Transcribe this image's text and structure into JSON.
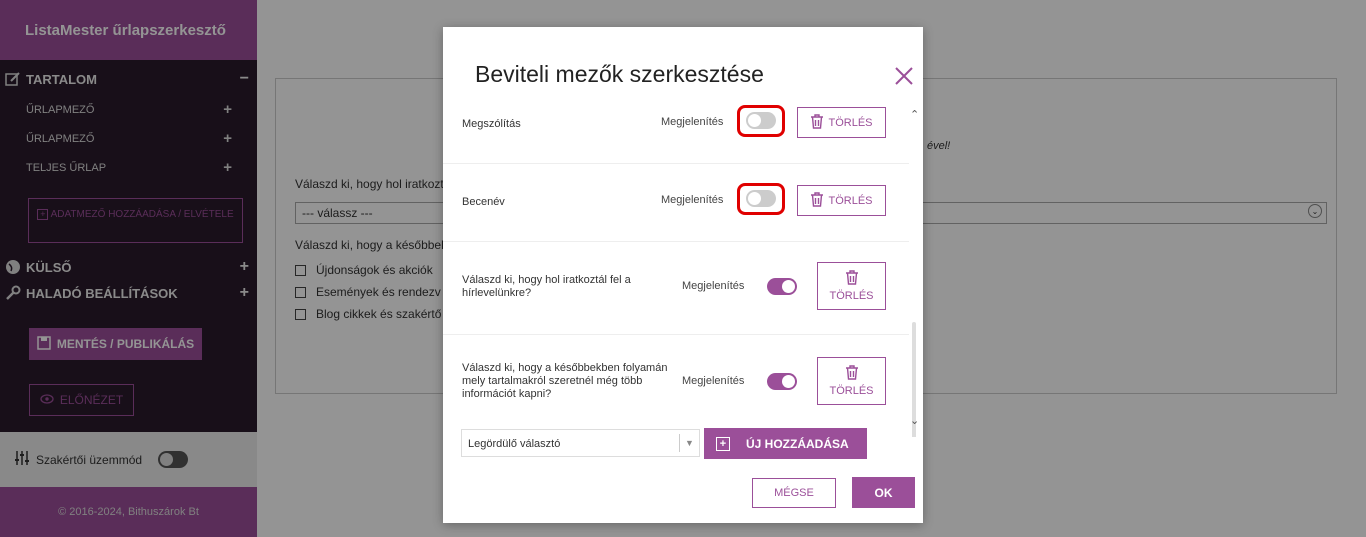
{
  "sidebar": {
    "title": "ListaMester űrlapszerkesztő",
    "section_content": "TARTALOM",
    "section_content_toggle": "−",
    "items": [
      {
        "label": "ŰRLAPMEZŐ",
        "toggle": "+"
      },
      {
        "label": "ŰRLAPMEZŐ",
        "toggle": "+"
      },
      {
        "label": "TELJES ŰRLAP",
        "toggle": "+"
      }
    ],
    "add_field_button": "ADATMEZŐ HOZZÁADÁSA / ELVÉTELE",
    "section_external": "KÜLSŐ",
    "section_external_toggle": "+",
    "section_advanced": "HALADÓ BEÁLLÍTÁSOK",
    "section_advanced_toggle": "+",
    "save_button": "MENTÉS / PUBLIKÁLÁS",
    "preview_button": "ELŐNÉZET",
    "expert_mode_label": "Szakértői üzemmód",
    "expert_mode_on": false,
    "footer": "© 2016-2024, Bithuszárok Bt"
  },
  "background": {
    "italic_fragment": "ével!",
    "question1": "Válaszd ki, hogy hol iratkozt",
    "select_placeholder": "--- válassz ---",
    "question2": "Válaszd ki, hogy a későbbek",
    "checkboxes": [
      "Újdonságok és akciók",
      "Események és rendezv",
      "Blog cikkek és szakértő"
    ]
  },
  "modal": {
    "title": "Beviteli mezők szerkesztése",
    "show_label": "Megjelenítés",
    "delete_label": "TÖRLÉS",
    "fields": [
      {
        "label": "Megszólítás",
        "visible": false
      },
      {
        "label": "Becenév",
        "visible": false
      },
      {
        "label": "Válaszd ki, hogy hol iratkoztál fel a hírlevelünkre?",
        "visible": true
      },
      {
        "label": "Válaszd ki, hogy a későbbekben folyamán mely tartalmakról szeretnél még több információt kapni?",
        "visible": true
      }
    ],
    "type_select_value": "Legördülő választó",
    "add_button": "ÚJ HOZZÁADÁSA",
    "cancel_button": "MÉGSE",
    "ok_button": "OK"
  },
  "colors": {
    "accent": "#9b4f99",
    "sidebar_bg": "#2a1a2b",
    "highlight": "#e00000"
  }
}
